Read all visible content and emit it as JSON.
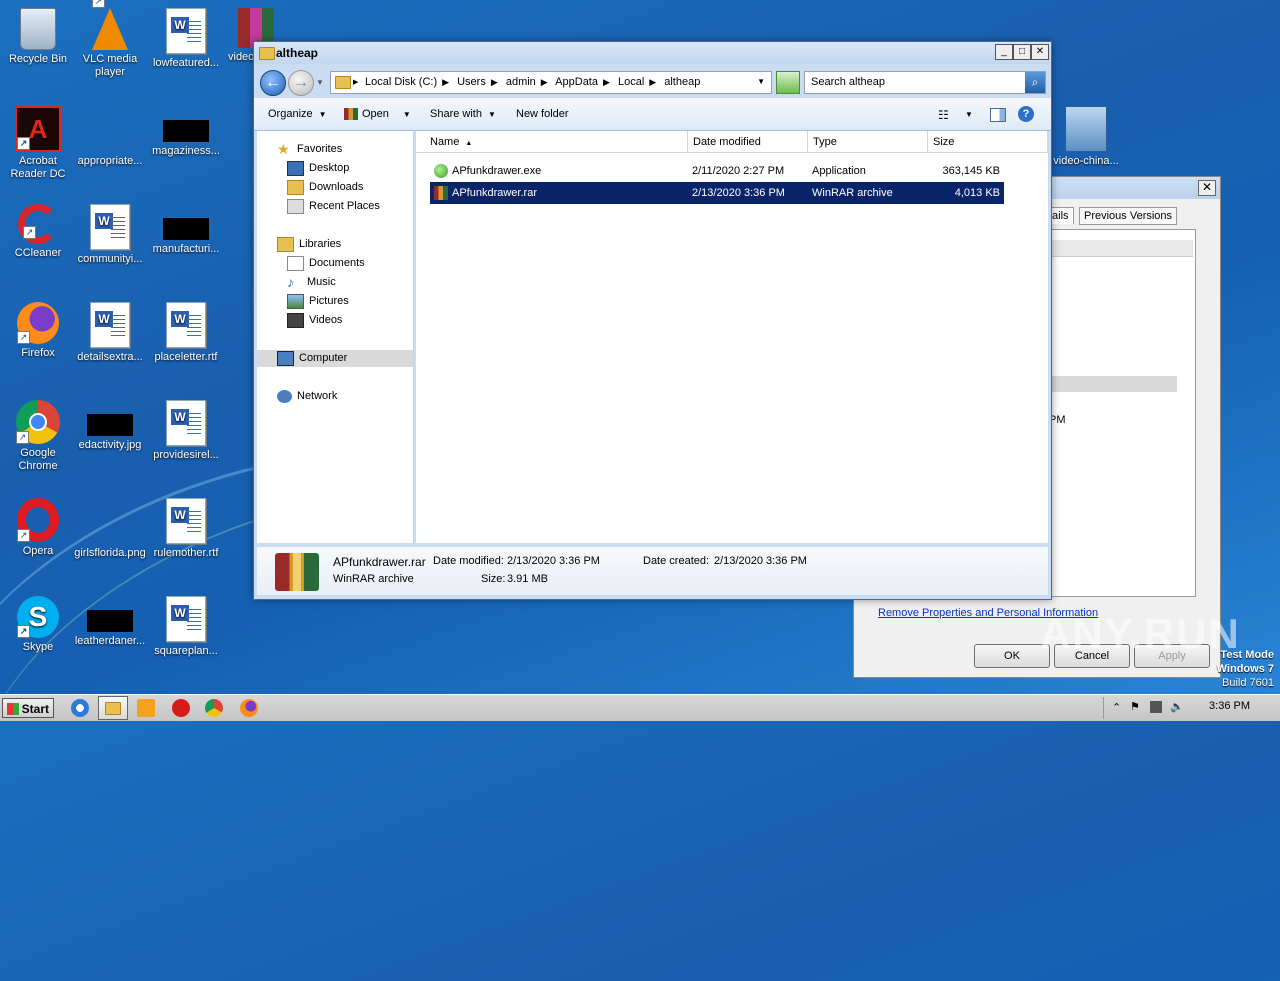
{
  "desktop": {
    "icons": [
      {
        "label": "Recycle Bin"
      },
      {
        "label": "VLC media player"
      },
      {
        "label": "lowfeatured..."
      },
      {
        "label": "video"
      },
      {
        "label": "Acrobat Reader DC"
      },
      {
        "label": "appropriate..."
      },
      {
        "label": "magaziness..."
      },
      {
        "label": "CCleaner"
      },
      {
        "label": "communityi..."
      },
      {
        "label": "manufacturi..."
      },
      {
        "label": "Firefox"
      },
      {
        "label": "detailsextra..."
      },
      {
        "label": "placeletter.rtf"
      },
      {
        "label": "Google Chrome"
      },
      {
        "label": "edactivity.jpg"
      },
      {
        "label": "providesirel..."
      },
      {
        "label": "Opera"
      },
      {
        "label": "girlsflorida.png"
      },
      {
        "label": "rulemother.rtf"
      },
      {
        "label": "Skype"
      },
      {
        "label": "leatherdaner..."
      },
      {
        "label": "squareplan..."
      },
      {
        "label": "video-china..."
      }
    ]
  },
  "properties": {
    "tab_details": "tails",
    "tab_prev": "Previous Versions",
    "partial_text": "PM",
    "remove_link": "Remove Properties and Personal Information",
    "ok": "OK",
    "cancel": "Cancel",
    "apply": "Apply"
  },
  "explorer": {
    "title": "altheap",
    "breadcrumbs": [
      "Local Disk (C:)",
      "Users",
      "admin",
      "AppData",
      "Local",
      "altheap"
    ],
    "search_placeholder": "Search altheap",
    "toolbar": {
      "organize": "Organize",
      "open": "Open",
      "share": "Share with",
      "new_folder": "New folder"
    },
    "nav": {
      "favorites": "Favorites",
      "desktop": "Desktop",
      "downloads": "Downloads",
      "recent": "Recent Places",
      "libraries": "Libraries",
      "documents": "Documents",
      "music": "Music",
      "pictures": "Pictures",
      "videos": "Videos",
      "computer": "Computer",
      "network": "Network"
    },
    "columns": {
      "name": "Name",
      "date": "Date modified",
      "type": "Type",
      "size": "Size"
    },
    "files": [
      {
        "name": "APfunkdrawer.exe",
        "date": "2/11/2020 2:27 PM",
        "type": "Application",
        "size": "363,145 KB"
      },
      {
        "name": "APfunkdrawer.rar",
        "date": "2/13/2020 3:36 PM",
        "type": "WinRAR archive",
        "size": "4,013 KB"
      }
    ],
    "status": {
      "name": "APfunkdrawer.rar",
      "type": "WinRAR archive",
      "modified_label": "Date modified:",
      "modified": "2/13/2020 3:36 PM",
      "created_label": "Date created:",
      "created": "2/13/2020 3:36 PM",
      "size_label": "Size:",
      "size": "3.91 MB"
    }
  },
  "taskbar": {
    "start": "Start",
    "time": "3:36 PM"
  },
  "overlay": {
    "watermark": "ANY.RUN",
    "test_mode": "Test Mode",
    "os": "Windows 7",
    "build": "Build 7601"
  }
}
